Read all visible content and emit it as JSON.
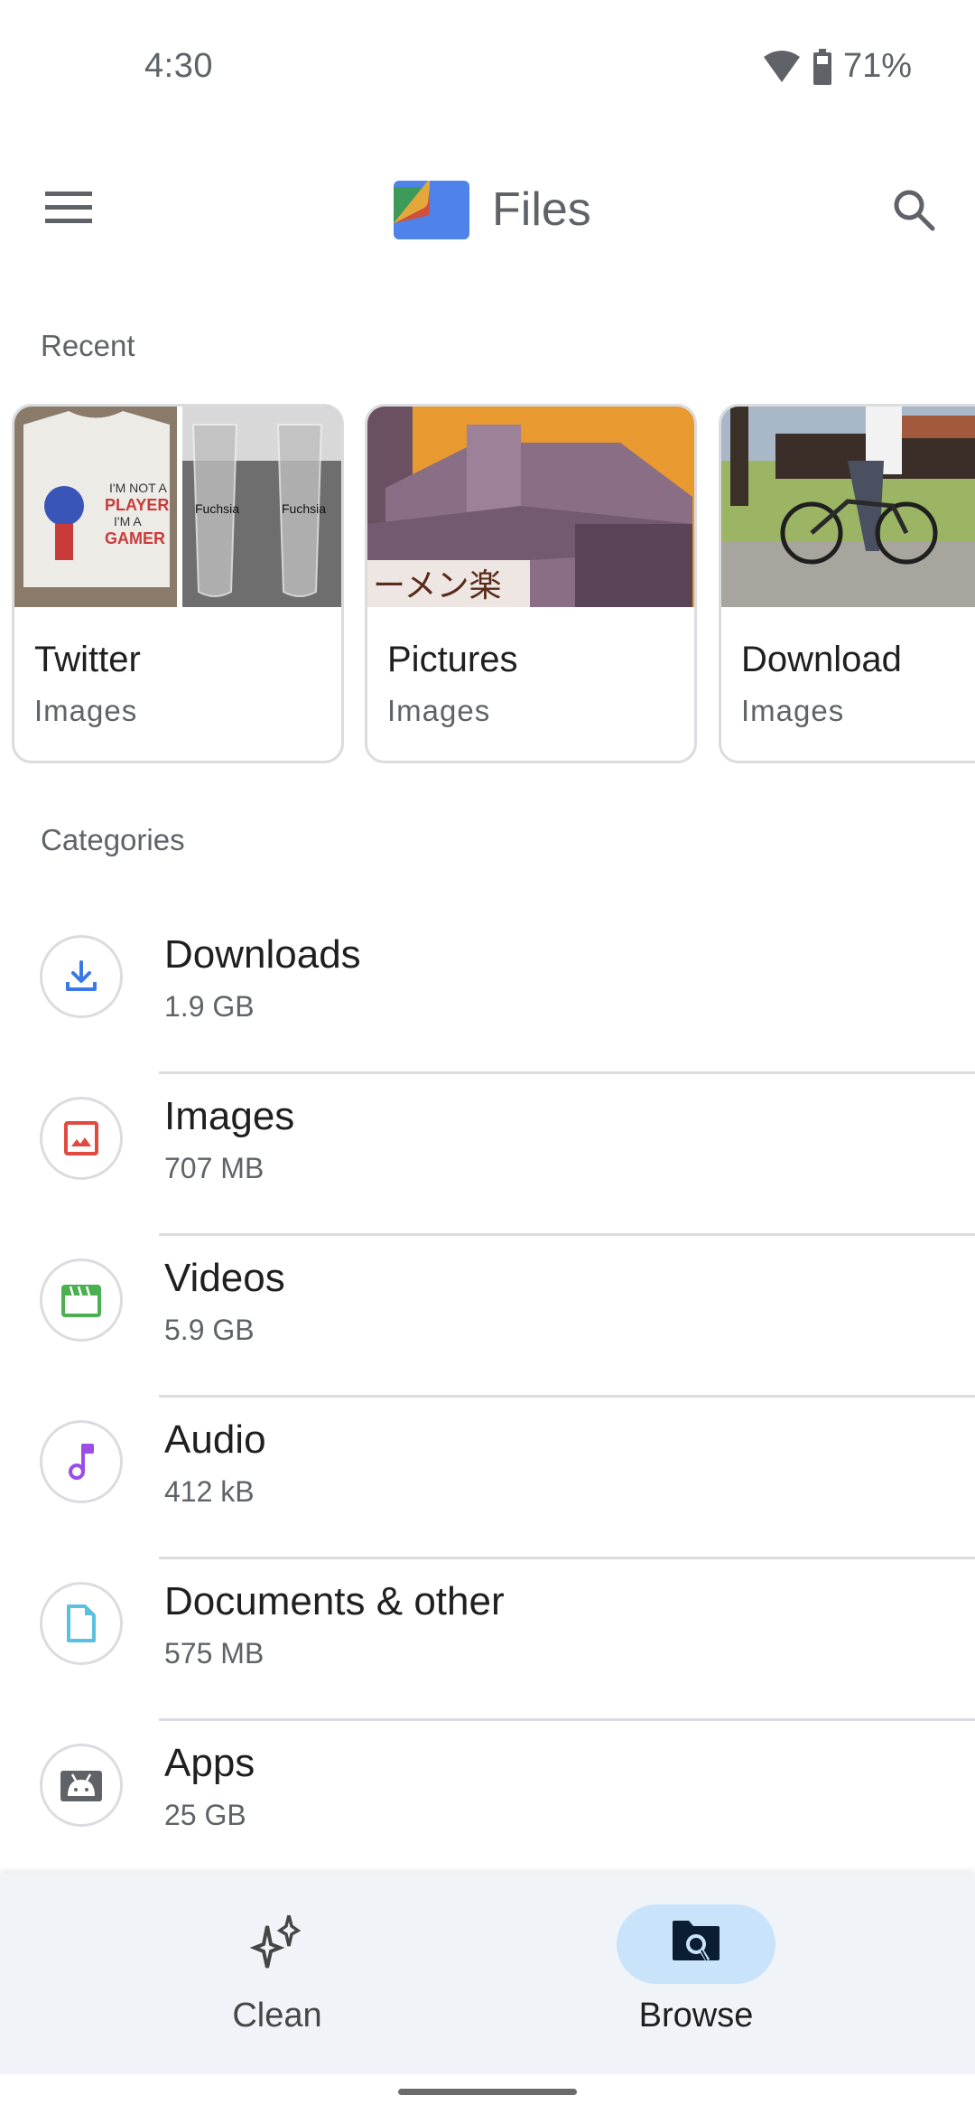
{
  "status_bar": {
    "time": "4:30",
    "wifi_icon": "wifi-icon",
    "battery_icon": "battery-icon",
    "battery_percent": "71%"
  },
  "app_bar": {
    "menu_icon": "menu-icon",
    "title": "Files",
    "search_icon": "search-icon"
  },
  "recent": {
    "label": "Recent",
    "cards": [
      {
        "title": "Twitter",
        "subtitle": "Images",
        "thumbnails": [
          "t-shirt photo",
          "Fuchsia glasses photo"
        ]
      },
      {
        "title": "Pictures",
        "subtitle": "Images",
        "thumbnails": [
          "anime ramen shop illustration"
        ]
      },
      {
        "title": "Download",
        "subtitle": "Images",
        "thumbnails": [
          "person riding bicycle photo"
        ]
      }
    ]
  },
  "categories": {
    "label": "Categories",
    "items": [
      {
        "name": "Downloads",
        "size": "1.9 GB",
        "icon": "download-icon",
        "color": "#3b78e7"
      },
      {
        "name": "Images",
        "size": "707 MB",
        "icon": "image-icon",
        "color": "#e04a3f"
      },
      {
        "name": "Videos",
        "size": "5.9 GB",
        "icon": "video-clapper-icon",
        "color": "#4caf50"
      },
      {
        "name": "Audio",
        "size": "412 kB",
        "icon": "music-note-icon",
        "color": "#9b4de6"
      },
      {
        "name": "Documents & other",
        "size": "575 MB",
        "icon": "document-icon",
        "color": "#5bc0de"
      },
      {
        "name": "Apps",
        "size": "25 GB",
        "icon": "android-icon",
        "color": "#5f6368"
      }
    ]
  },
  "bottom_nav": {
    "items": [
      {
        "label": "Clean",
        "icon": "sparkle-icon",
        "active": false
      },
      {
        "label": "Browse",
        "icon": "folder-search-icon",
        "active": true
      }
    ]
  }
}
